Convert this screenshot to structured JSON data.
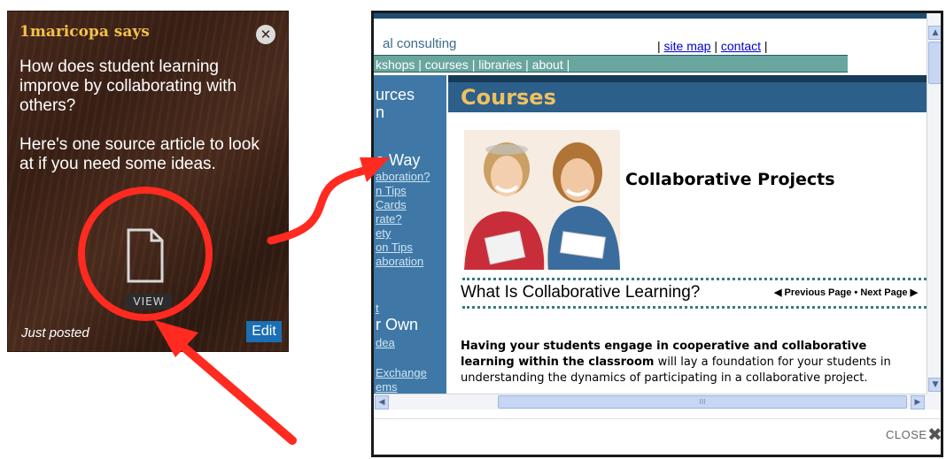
{
  "post": {
    "author_line": "1maricopa says",
    "question": "How does student learning improve by collaborating with others?",
    "hint": "Here's one source article to look at if you need some ideas.",
    "view_label": "VIEW",
    "timestamp": "Just posted",
    "edit_label": "Edit",
    "close_icon": "close-icon",
    "attachment_icon": "document-icon"
  },
  "popup": {
    "logo_fragment": "▃ ",
    "tagline": "al consulting",
    "util_links": {
      "sep": "|",
      "site_map": "site map",
      "contact": "contact"
    },
    "nav": [
      "kshops",
      "courses",
      "libraries",
      "about"
    ],
    "nav_sep": "|",
    "left_col": {
      "h1": "urces",
      "h1b": "n",
      "h2": "e Way",
      "links": [
        "aboration?",
        "n Tips",
        "Cards",
        "rate?",
        "ety",
        "on Tips",
        "aboration"
      ],
      "t": "t",
      "h3": "r Own",
      "links2": [
        "dea",
        "Exchange",
        "ems"
      ]
    },
    "page_title": "Courses",
    "project_title": "Collaborative Projects",
    "section_heading": "What Is Collaborative Learning?",
    "pager": {
      "prev": "Previous Page",
      "dot": "•",
      "next": "Next Page"
    },
    "body": {
      "bold": "Having your students engage in cooperative and collaborative learning within the classroom",
      "rest": " will lay a foundation for your students in understanding the dynamics of participating in a collaborative project."
    },
    "scrollbar": {
      "thumb_grip": "III"
    },
    "close_label": "CLOSE",
    "close_icon": "✖"
  },
  "colors": {
    "author": "#f2c14a",
    "annotation": "#ff2a20",
    "edit_button": "#1a6fb5",
    "course_header": "#2c5f8a",
    "course_title": "#f0c060",
    "nav_bar": "#6aa6a0",
    "left_col": "#3f78a6"
  }
}
